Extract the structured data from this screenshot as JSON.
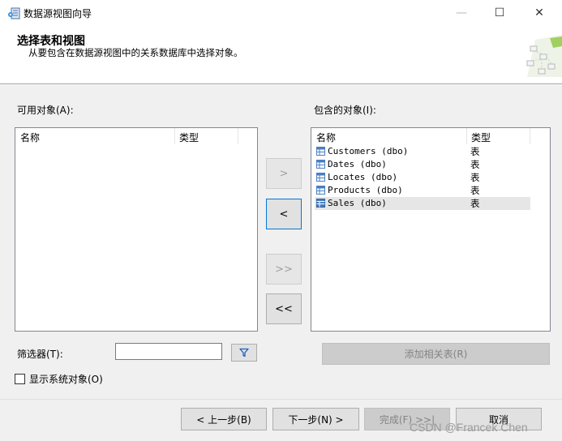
{
  "window": {
    "title": "数据源视图向导",
    "minimize_glyph": "—",
    "maximize_glyph": "☐",
    "close_glyph": "✕"
  },
  "header": {
    "title": "选择表和视图",
    "subtitle": "从要包含在数据源视图中的关系数据库中选择对象。"
  },
  "available": {
    "label": "可用对象(A):",
    "columns": [
      "名称",
      "类型"
    ],
    "items": []
  },
  "included": {
    "label": "包含的对象(I):",
    "columns": [
      "名称",
      "类型"
    ],
    "items": [
      {
        "name": "Customers (dbo)",
        "type": "表",
        "selected": false
      },
      {
        "name": "Dates (dbo)",
        "type": "表",
        "selected": false
      },
      {
        "name": "Locates (dbo)",
        "type": "表",
        "selected": false
      },
      {
        "name": "Products (dbo)",
        "type": "表",
        "selected": false
      },
      {
        "name": "Sales (dbo)",
        "type": "表",
        "selected": true
      }
    ]
  },
  "transfer_buttons": {
    "add": ">",
    "remove": "<",
    "add_all": ">>",
    "remove_all": "<<"
  },
  "filter": {
    "label": "筛选器(T):",
    "value": "",
    "icon": "filter-icon"
  },
  "add_related_label": "添加相关表(R)",
  "show_system_objects": {
    "label": "显示系统对象(O)",
    "checked": false
  },
  "footer": {
    "back": "< 上一步(B)",
    "next": "下一步(N) >",
    "finish": "完成(F) >>|",
    "cancel": "取消"
  },
  "watermark": "CSDN @Francek Chen",
  "colors": {
    "table_icon": "#4a7fc1",
    "focus_border": "#0078d7",
    "filter_icon": "#1e5fbf"
  }
}
